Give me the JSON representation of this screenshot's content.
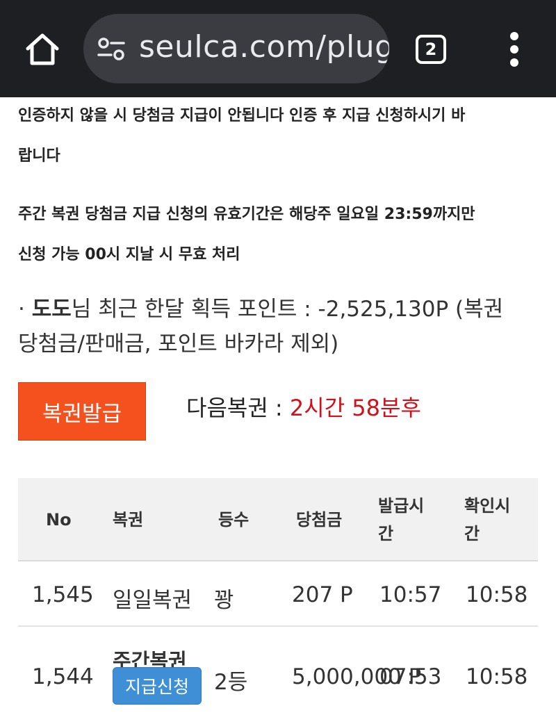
{
  "browser": {
    "url": "seulca.com/plugi",
    "tab_count": "2"
  },
  "notices": [
    "인증하지 않을 시 당첨금 지급이 안됩니다 인증 후 지급 신청하시기 바",
    "랍니다",
    "주간 복권 당첨금 지급 신청의 유효기간은 해당주 일요일 23:59까지만",
    "신청 가능 00시 지날 시 무효 처리"
  ],
  "points": {
    "bullet": "·",
    "nickname": "도도",
    "text_line1": "님 최근 한달 획득 포인트 : -2,525,130P (복권",
    "text_line2": "당첨금/판매금, 포인트 바카라 제외)"
  },
  "issue_button_label": "복권발급",
  "next_lottery": {
    "label": "다음복권 : ",
    "time": "2시간 58분후"
  },
  "table": {
    "headers": {
      "no": "No",
      "lottery": "복권",
      "rank": "등수",
      "prize": "당첨금",
      "issued_l1": "발급시",
      "issued_l2": "간",
      "checked_l1": "확인시",
      "checked_l2": "간"
    },
    "rows": [
      {
        "no": "1,545",
        "lottery": "일일복권",
        "rank": "꽝",
        "prize": "207 P",
        "issued": "10:57",
        "checked": "10:58"
      },
      {
        "no": "1,544",
        "lottery": "주간복권",
        "rank": "2등",
        "prize": "5,000,000 P",
        "issued": "07:53",
        "checked": "10:58",
        "action": "지급신청"
      }
    ]
  },
  "colors": {
    "chrome_bg": "#1e1f22",
    "issue_button": "#f4511e",
    "next_time": "#d0101a",
    "claim_button": "#3e8fd6"
  }
}
